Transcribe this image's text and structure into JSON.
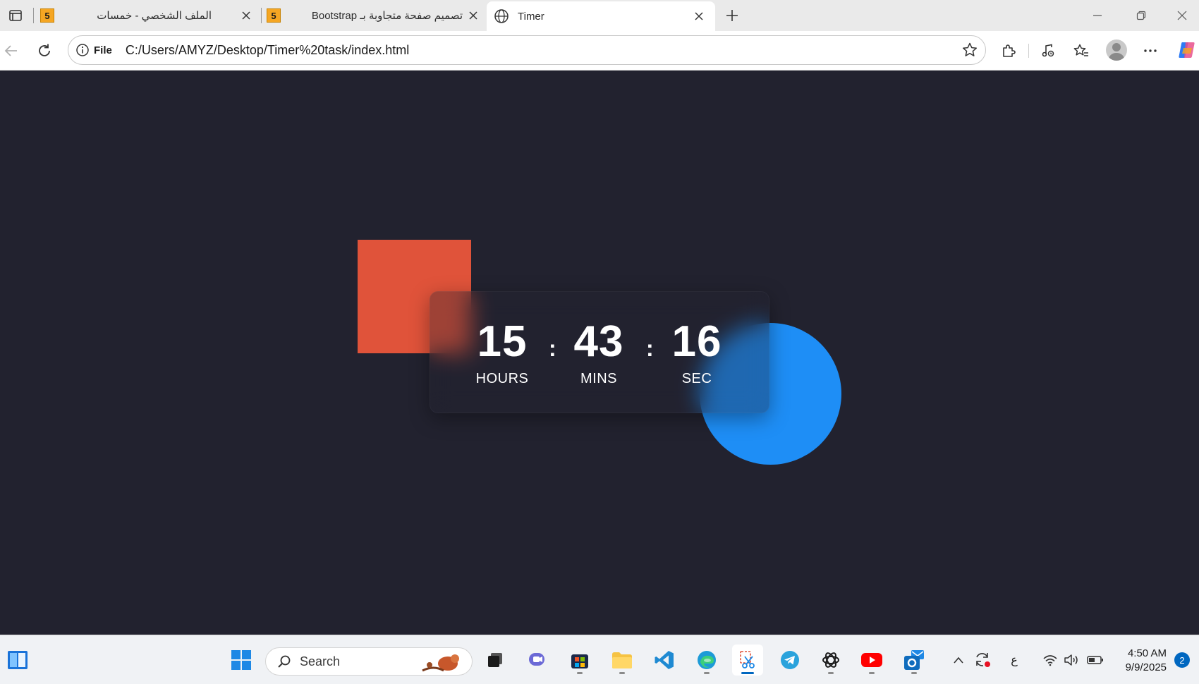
{
  "browser": {
    "tabs": [
      {
        "title": "الملف الشخصي - خمسات",
        "favicon": "khamsat-5-icon",
        "badge": "5",
        "active": false
      },
      {
        "title": "تصميم صفحة متجاوبة بـ Bootstrap",
        "favicon": "khamsat-5-icon",
        "badge": "5",
        "active": false
      },
      {
        "title": "Timer",
        "favicon": "globe-icon",
        "active": true
      }
    ],
    "address": {
      "site_label": "File",
      "url": "C:/Users/AMYZ/Desktop/Timer%20task/index.html"
    }
  },
  "page": {
    "timer": {
      "hours": {
        "value": "15",
        "label": "HOURS"
      },
      "mins": {
        "value": "43",
        "label": "MINS"
      },
      "sec": {
        "value": "16",
        "label": "SEC"
      },
      "separator": ":"
    },
    "colors": {
      "background": "#22222f",
      "square": "#e0533a",
      "circle": "#1e8ef6",
      "text": "#ffffff"
    }
  },
  "taskbar": {
    "search_placeholder": "Search",
    "ime_indicator": "ع",
    "time": "4:50 AM",
    "date": "9/9/2025",
    "notification_count": "2",
    "apps": [
      "widgets-icon",
      "start-icon",
      "task-view-icon",
      "chat-icon",
      "store-icon",
      "file-explorer-icon",
      "vscode-icon",
      "edge-icon",
      "snipping-tool-icon",
      "telegram-icon",
      "chatgpt-icon",
      "youtube-icon",
      "outlook-icon"
    ]
  }
}
